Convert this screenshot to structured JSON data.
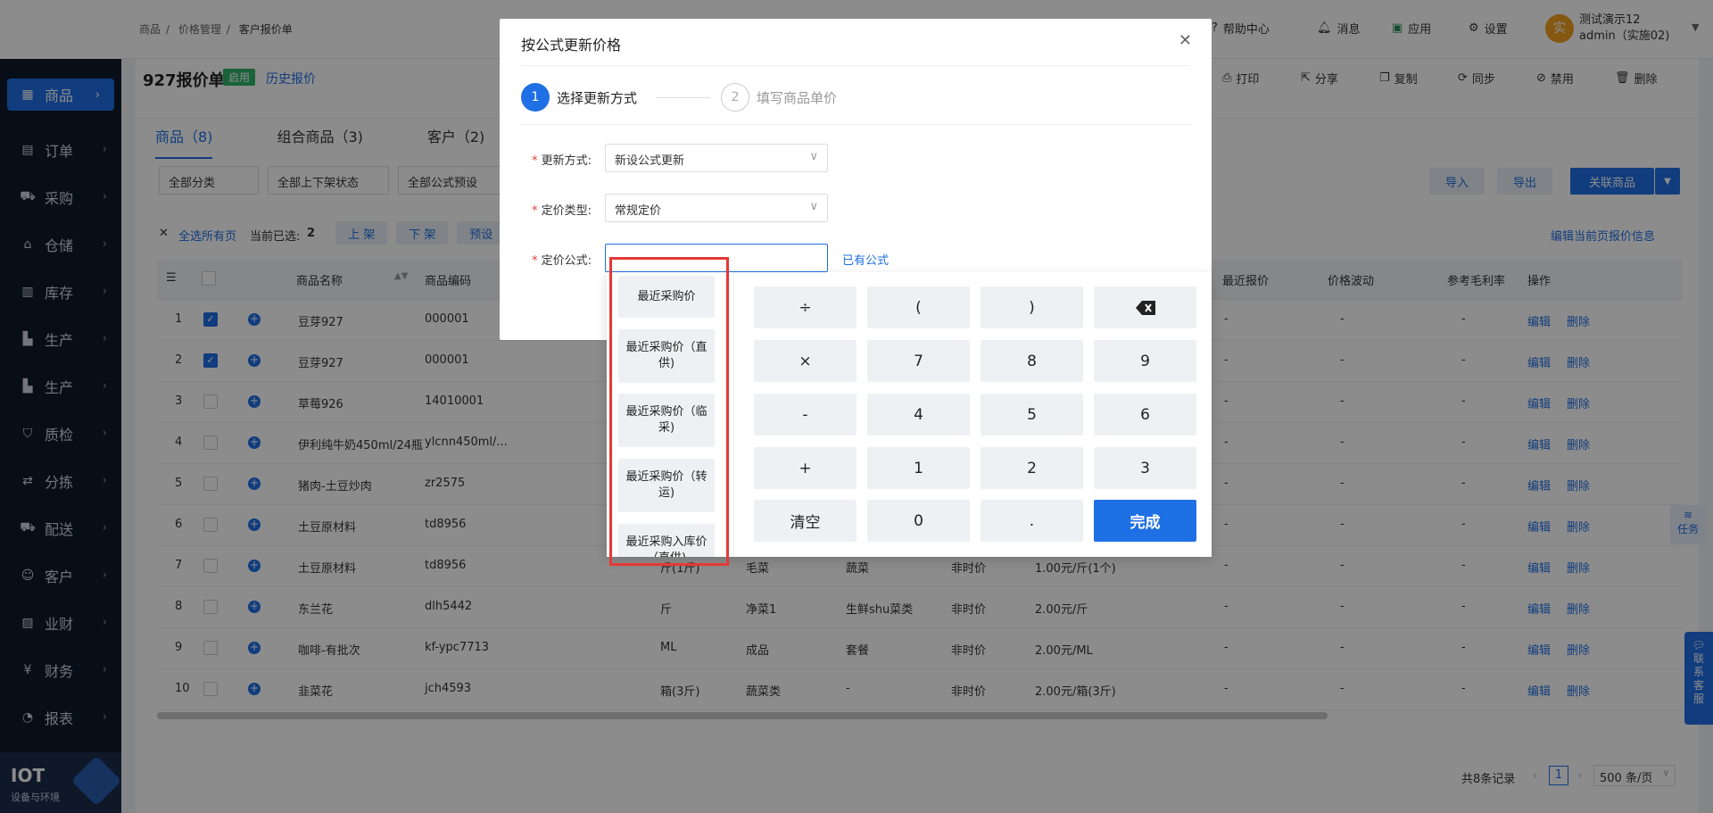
{
  "breadcrumb": [
    "商品",
    "价格管理",
    "客户报价单"
  ],
  "topbar": {
    "help": "帮助中心",
    "messages": "消息",
    "apps": "应用",
    "settings": "设置",
    "avatar_char": "实",
    "user_name": "测试演示12",
    "user_role": "admin（实施02)"
  },
  "sidebar": {
    "items": [
      {
        "label": "商品",
        "icon": "grid-icon"
      },
      {
        "label": "订单",
        "icon": "order-icon"
      },
      {
        "label": "采购",
        "icon": "cart-icon"
      },
      {
        "label": "仓储",
        "icon": "warehouse-icon"
      },
      {
        "label": "库存",
        "icon": "stock-icon"
      },
      {
        "label": "生产",
        "icon": "factory-icon"
      },
      {
        "label": "生产",
        "icon": "factory-icon"
      },
      {
        "label": "质检",
        "icon": "shield-icon"
      },
      {
        "label": "分拣",
        "icon": "sort-icon"
      },
      {
        "label": "配送",
        "icon": "truck-icon"
      },
      {
        "label": "客户",
        "icon": "user-icon"
      },
      {
        "label": "业财",
        "icon": "finance-icon"
      },
      {
        "label": "财务",
        "icon": "money-icon"
      },
      {
        "label": "报表",
        "icon": "report-icon"
      }
    ],
    "iot_title": "IOT",
    "iot_sub": "设备与环境"
  },
  "page": {
    "title": "927报价单",
    "status": "启用",
    "history": "历史报价",
    "actions": [
      "打印",
      "分享",
      "复制",
      "同步",
      "禁用",
      "删除"
    ],
    "tabs": [
      "商品（8)",
      "组合商品（3)",
      "客户（2)"
    ],
    "filters": [
      "全部分类",
      "全部上下架状态",
      "全部公式预设"
    ],
    "btn_import": "导入",
    "btn_export": "导出",
    "btn_link": "关联商品",
    "select_all": "全选所有页",
    "selected_label": "当前已选:",
    "selected_count": "2",
    "batch": [
      "上 架",
      "下 架",
      "预设"
    ],
    "edit_page_price": "编辑当前页报价信息",
    "task": "任务",
    "contact": "联系客服"
  },
  "table": {
    "headers": {
      "name": "商品名称",
      "code": "商品编码",
      "recent_price": "最近报价",
      "fluctuation": "价格波动",
      "margin": "参考毛利率",
      "ops": "操作"
    },
    "edit": "编辑",
    "delete": "删除",
    "rows": [
      {
        "idx": "1",
        "checked": true,
        "name": "豆芽927",
        "code": "000001",
        "unit": "",
        "cat1": "",
        "cat2": "",
        "ptype": "",
        "price": "",
        "recent": "-",
        "fluct": "-",
        "margin": "-"
      },
      {
        "idx": "2",
        "checked": true,
        "name": "豆芽927",
        "code": "000001",
        "unit": "",
        "cat1": "",
        "cat2": "",
        "ptype": "",
        "price": "",
        "recent": "-",
        "fluct": "-",
        "margin": "-"
      },
      {
        "idx": "3",
        "checked": false,
        "name": "草莓926",
        "code": "14010001",
        "unit": "",
        "cat1": "",
        "cat2": "",
        "ptype": "",
        "price": "",
        "recent": "-",
        "fluct": "-",
        "margin": "-"
      },
      {
        "idx": "4",
        "checked": false,
        "name": "伊利纯牛奶450ml/24瓶",
        "code": "ylcnn450ml/...",
        "unit": "",
        "cat1": "",
        "cat2": "",
        "ptype": "",
        "price": "",
        "recent": "-",
        "fluct": "-",
        "margin": "-"
      },
      {
        "idx": "5",
        "checked": false,
        "name": "猪肉-土豆炒肉",
        "code": "zr2575",
        "unit": "",
        "cat1": "",
        "cat2": "",
        "ptype": "",
        "price": "",
        "recent": "-",
        "fluct": "-",
        "margin": "-"
      },
      {
        "idx": "6",
        "checked": false,
        "name": "土豆原材料",
        "code": "td8956",
        "unit": "",
        "cat1": "",
        "cat2": "",
        "ptype": "",
        "price": "",
        "recent": "-",
        "fluct": "-",
        "margin": "-"
      },
      {
        "idx": "7",
        "checked": false,
        "name": "土豆原材料",
        "code": "td8956",
        "unit": "斤(1斤)",
        "cat1": "毛菜",
        "cat2": "蔬菜",
        "ptype": "非时价",
        "price": "1.00元/斤(1个)",
        "recent": "-",
        "fluct": "-",
        "margin": "-"
      },
      {
        "idx": "8",
        "checked": false,
        "name": "东兰花",
        "code": "dlh5442",
        "unit": "斤",
        "cat1": "净菜1",
        "cat2": "生鲜shu菜类",
        "ptype": "非时价",
        "price": "2.00元/斤",
        "recent": "-",
        "fluct": "-",
        "margin": "-"
      },
      {
        "idx": "9",
        "checked": false,
        "name": "咖啡-有批次",
        "code": "kf-ypc7713",
        "unit": "ML",
        "cat1": "成品",
        "cat2": "套餐",
        "ptype": "非时价",
        "price": "2.00元/ML",
        "recent": "-",
        "fluct": "-",
        "margin": "-"
      },
      {
        "idx": "10",
        "checked": false,
        "name": "韭菜花",
        "code": "jch4593",
        "unit": "箱(3斤)",
        "cat1": "蔬菜类",
        "cat2": "-",
        "ptype": "非时价",
        "price": "2.00元/箱(3斤)",
        "recent": "-",
        "fluct": "-",
        "margin": "-"
      }
    ]
  },
  "pagination": {
    "total": "共8条记录",
    "current": "1",
    "page_size": "500 条/页"
  },
  "modal": {
    "title": "按公式更新价格",
    "step1_num": "1",
    "step1": "选择更新方式",
    "step2_num": "2",
    "step2": "填写商品单价",
    "update_mode_label": "更新方式:",
    "update_mode_value": "新设公式更新",
    "price_type_label": "定价类型:",
    "price_type_value": "常规定价",
    "formula_label": "定价公式:",
    "formula_value": "",
    "existing_formula": "已有公式",
    "required_mark": "*"
  },
  "calculator": {
    "fields": [
      "最近采购价",
      "最近采购价（直供)",
      "最近采购价（临采)",
      "最近采购价（转运)",
      "最近采购入库价（直供)"
    ],
    "keys": [
      "÷",
      "(",
      ")",
      "×",
      "7",
      "8",
      "9",
      "-",
      "4",
      "5",
      "6",
      "+",
      "1",
      "2",
      "3",
      "清空",
      "0",
      "."
    ],
    "done": "完成",
    "highlight_color": "#e53935"
  }
}
